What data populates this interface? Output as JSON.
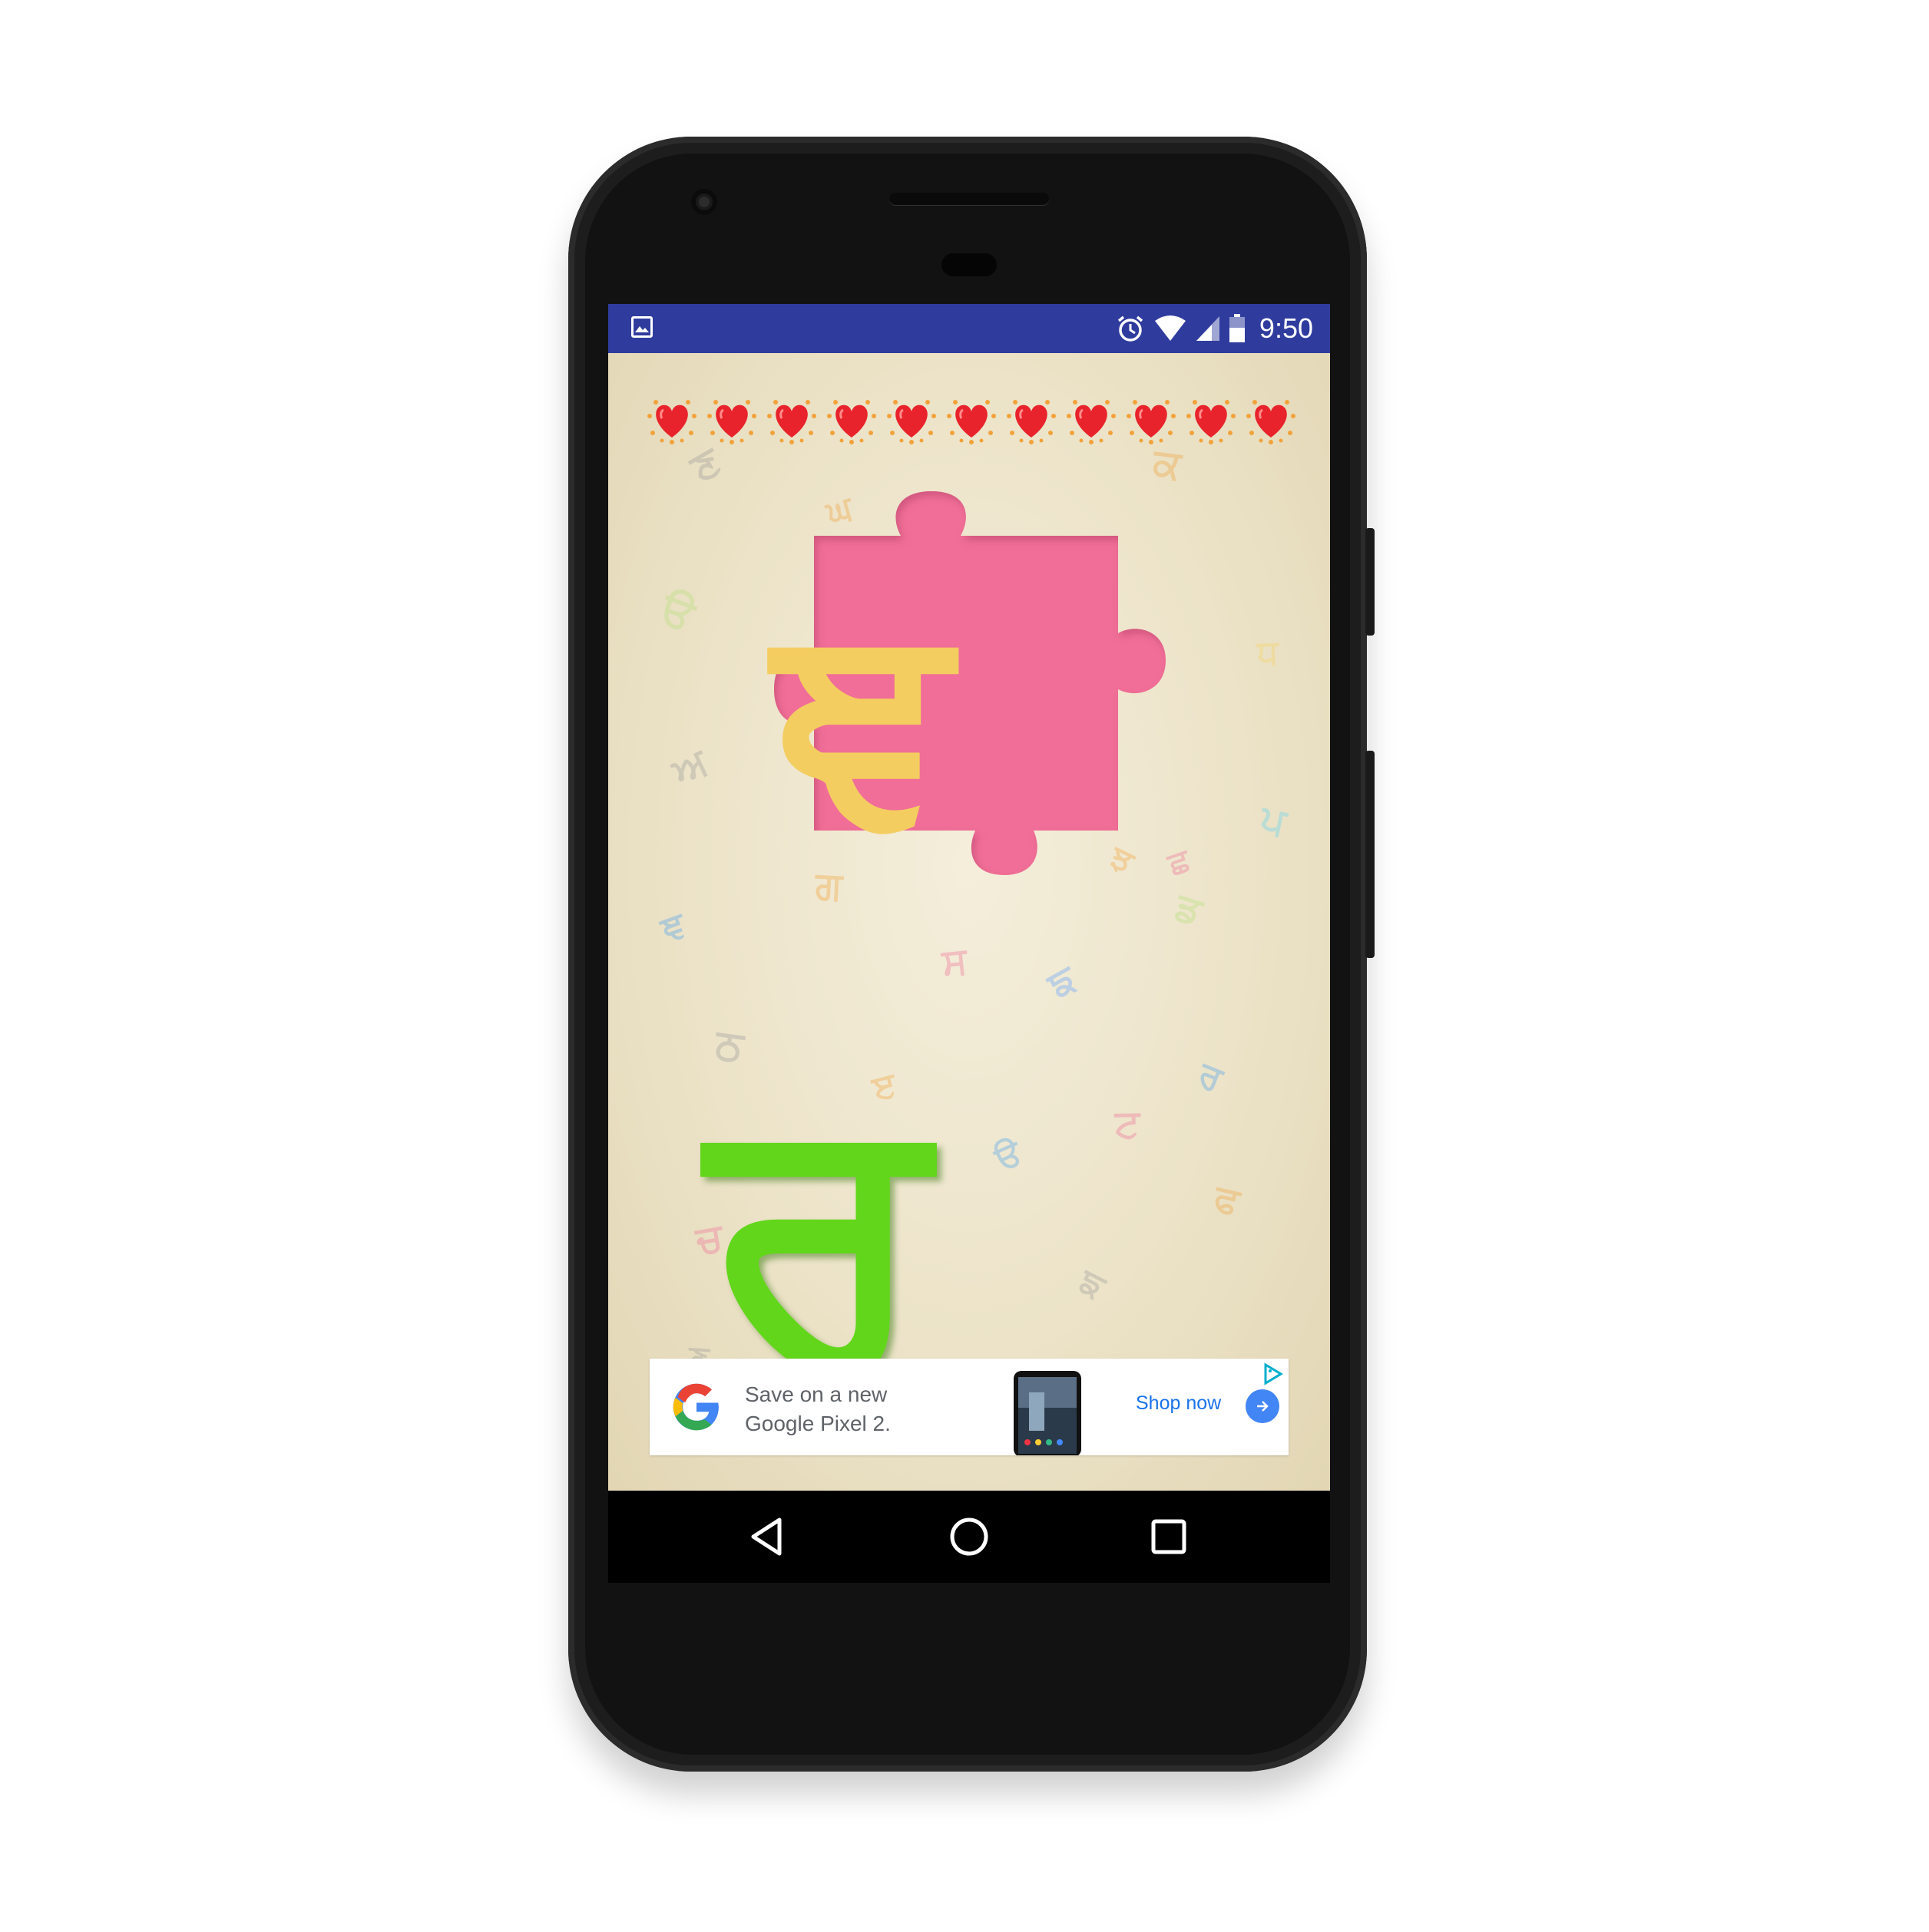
{
  "status_bar": {
    "time": "9:50",
    "left_icon": "image-icon",
    "right_icons": [
      "alarm-icon",
      "wifi-icon",
      "signal-icon",
      "battery-icon"
    ]
  },
  "game": {
    "hearts_count": 11,
    "puzzle_letter": "ਞ",
    "answer_letter": "ਰ",
    "puzzle_color": "#f06e97",
    "puzzle_letter_color": "#f4cd60",
    "answer_letter_color": "#62d61b"
  },
  "background_letters": [
    "ਣ",
    "ਕ",
    "ਘ",
    "ੳ",
    "ਧ",
    "ਅ",
    "ਪ",
    "ਹ",
    "ਝ",
    "ਗ",
    "ਞ",
    "ਡ",
    "ਸ",
    "ਙ",
    "ਠ",
    "ੲ",
    "ਰ",
    "ਟ",
    "ੳ",
    "ਫ",
    "ਚ",
    "ਙ",
    "ਣ",
    "ਛ",
    "ਲ"
  ],
  "ad": {
    "line1": "Save on a new",
    "line2": "Google Pixel 2.",
    "cta": "Shop now",
    "brand_icon": "google-g-icon",
    "choices_icon": "adchoices-icon"
  },
  "nav": {
    "back": "back-icon",
    "home": "home-icon",
    "recents": "recents-icon"
  }
}
